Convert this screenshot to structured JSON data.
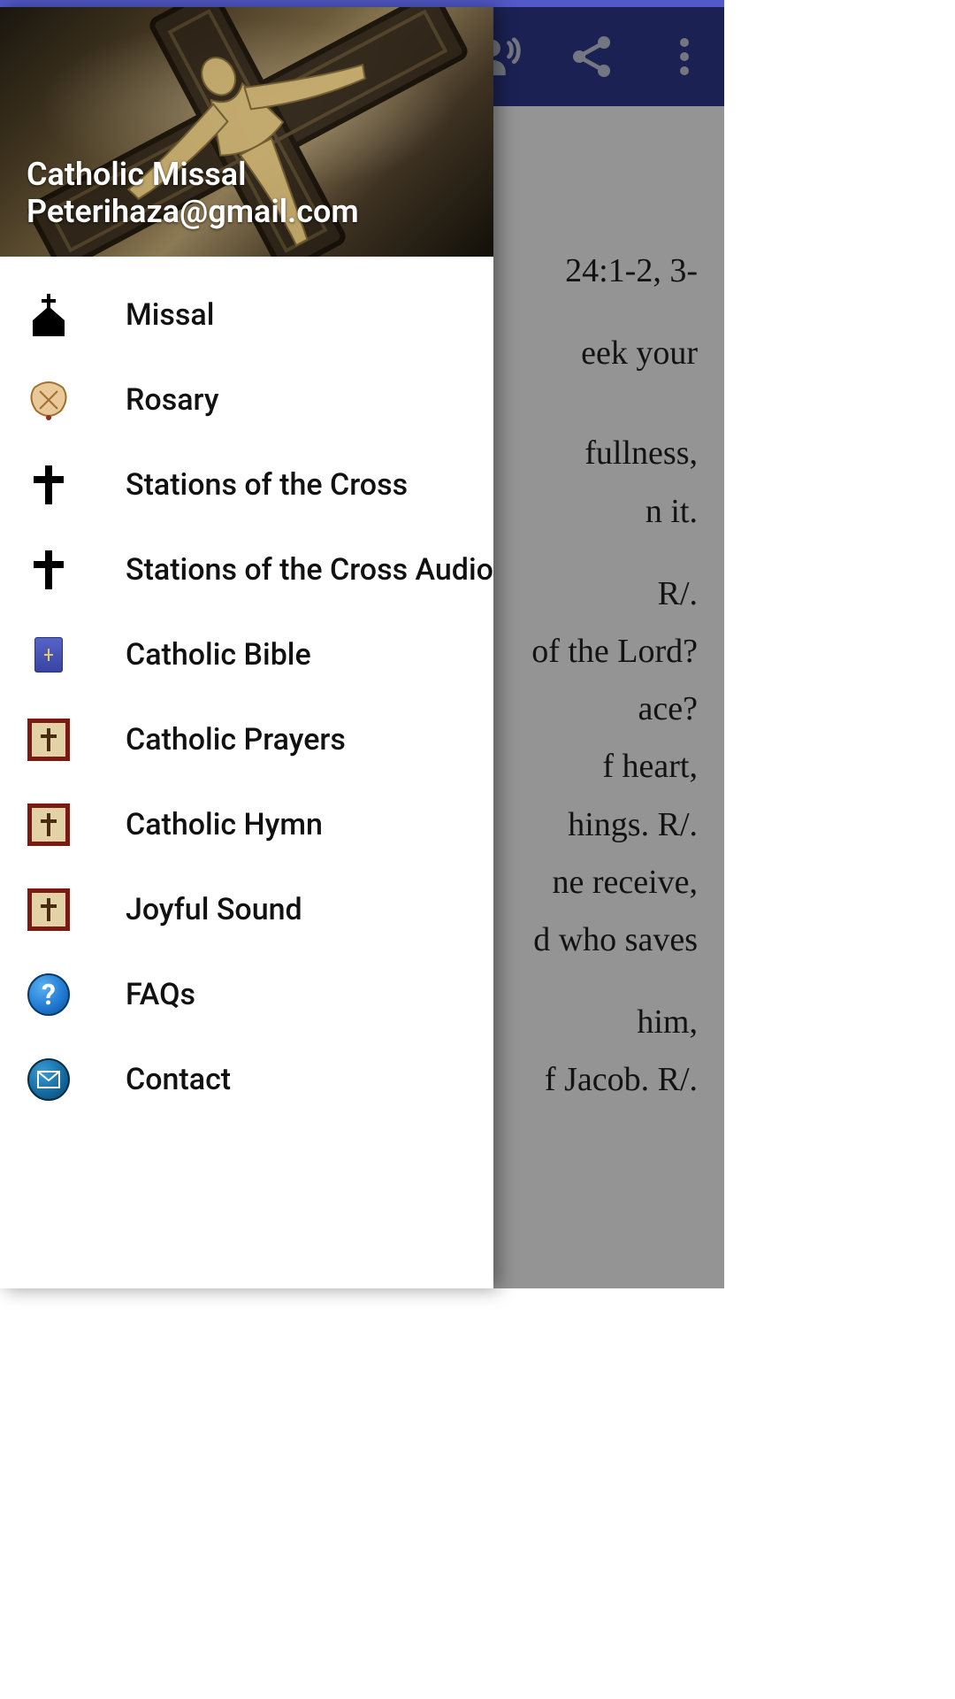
{
  "header": {
    "app_title": "Catholic Missal",
    "email": "Peterihaza@gmail.com"
  },
  "drawer": {
    "items": [
      {
        "label": "Missal",
        "icon": "church-icon"
      },
      {
        "label": "Rosary",
        "icon": "rosary-icon"
      },
      {
        "label": "Stations of the Cross",
        "icon": "cross-icon"
      },
      {
        "label": "Stations of the Cross Audio",
        "icon": "cross-icon"
      },
      {
        "label": "Catholic Bible",
        "icon": "bible-icon"
      },
      {
        "label": "Catholic Prayers",
        "icon": "framed-cross-icon"
      },
      {
        "label": "Catholic Hymn",
        "icon": "framed-cross-icon"
      },
      {
        "label": "Joyful Sound",
        "icon": "framed-cross-icon"
      },
      {
        "label": "FAQs",
        "icon": "question-circle-icon"
      },
      {
        "label": "Contact",
        "icon": "mail-circle-icon"
      }
    ]
  },
  "appbar": {
    "actions": [
      {
        "name": "voice-action",
        "icon": "person-voice-icon"
      },
      {
        "name": "share-action",
        "icon": "share-icon"
      },
      {
        "name": "overflow-menu",
        "icon": "more-vert-icon"
      }
    ]
  },
  "content": {
    "psalm_ref": "24:1-2, 3-",
    "lines": [
      "eek your",
      "fullness,",
      "n it.",
      "R/.",
      "of the Lord?",
      "ace?",
      "f heart,",
      "hings. R/.",
      "ne receive,",
      "d who saves",
      "him,",
      "f Jacob. R/."
    ]
  },
  "colors": {
    "primary": "#303c8f",
    "status": "#5259c9",
    "frame_red": "#7a1a12"
  }
}
